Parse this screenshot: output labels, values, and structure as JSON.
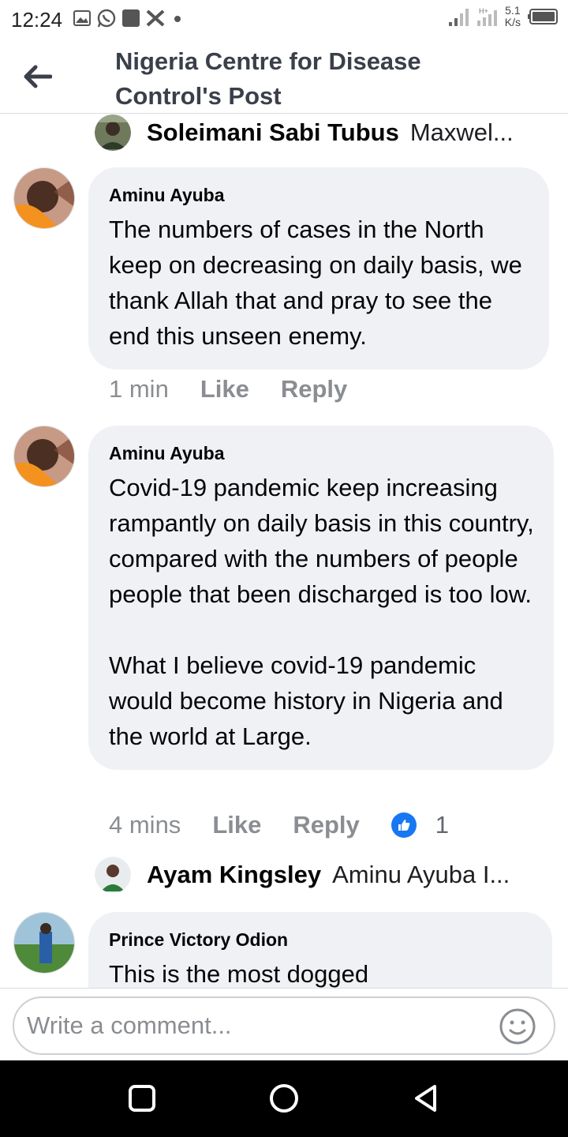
{
  "status_bar": {
    "time": "12:24",
    "speed_value": "5.1",
    "speed_unit": "K/s",
    "left_icons": [
      "gallery-icon",
      "whatsapp-icon",
      "app-icon",
      "x-icon",
      "dot-icon"
    ],
    "right_icons": [
      "signal-icon",
      "signal-2-icon",
      "battery-icon"
    ]
  },
  "header": {
    "title": "Nigeria Centre for Disease Control's Post"
  },
  "replies": [
    {
      "name": "Soleimani Sabi Tubus",
      "text": "Maxwel..."
    },
    {
      "name": "Ayam Kingsley",
      "text": "Aminu Ayuba I..."
    }
  ],
  "comments": [
    {
      "name": "Aminu Ayuba",
      "text": "The numbers of cases in  the North keep on decreasing on daily basis, we thank Allah that and pray to see the end this unseen enemy.",
      "time": "1 min",
      "like_label": "Like",
      "reply_label": "Reply"
    },
    {
      "name": "Aminu Ayuba",
      "text": "Covid-19 pandemic keep increasing rampantly on daily basis in this country, compared with the numbers of people people that been discharged is too low.\n\nWhat I believe covid-19 pandemic would become history in Nigeria and the world at Large.",
      "time": "4 mins",
      "like_label": "Like",
      "reply_label": "Reply",
      "reaction_count": "1"
    },
    {
      "name": "Prince Victory Odion",
      "text": "This is the most dogged"
    }
  ],
  "composer": {
    "placeholder": "Write a comment..."
  },
  "colors": {
    "accent": "#1877f2",
    "bubble": "#eff1f5",
    "muted_text": "#8a8d91"
  }
}
